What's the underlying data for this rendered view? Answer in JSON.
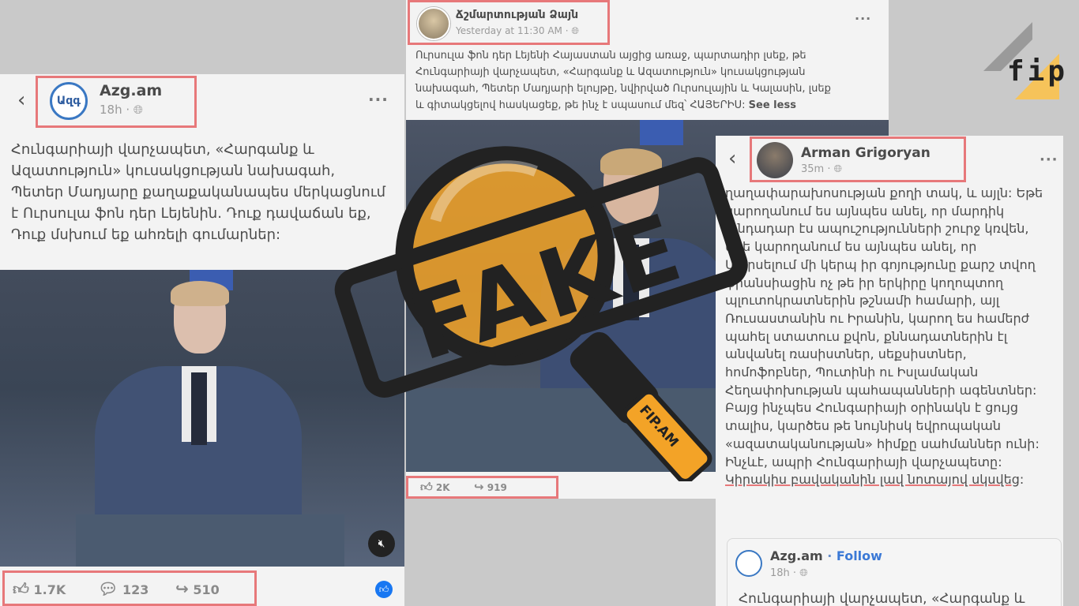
{
  "watermark": {
    "logo_text": "fip"
  },
  "post_center": {
    "page_name": "Ճշմարտության Ձայն",
    "time": "Yesterday at 11:30 AM · ",
    "text": "Ուրսուլա ֆոն դեր Լեյենի Հայաստան այցից առաջ, պարտադիր լսեք, թե Հունգարիայի վարչապետ, «Հարգանք և Ազատություն» կուսակցության նախագահ, Պետեր Մադյարի ելույթը, նվիրված Ուրսուլային և Կալասին, լսեք և գիտակցելով հասկացեք, թե ինչ է սպասում մեզ՝ ՀԱՅԵՐԻՍ: ",
    "see_less": "See less",
    "likes": "2K",
    "shares": "919"
  },
  "post_left": {
    "page_name": "Azg.am",
    "avatar_text": "Ազգ",
    "time": "18h · ",
    "text": "Հունգարիայի վարչապետ, «Հարգանք և Ազատություն» կուսակցության նախագահ, Պետեր Մադյարը քաղաքականապես մերկացնում է Ուրսուլա ֆոն դեր Լեյենին. Դուք դավաճան եք, Դուք մսխում եք ահռելի գումարներ:",
    "likes": "1.7K",
    "comments": "123",
    "shares": "510"
  },
  "post_right": {
    "author": "Arman Grigoryan",
    "time": "35m · ",
    "text": "ղաղափարախոսության քողի տակ, և այլն: Եթե կարողանում ես այնպես անել, որ մարդիկ անդադար էս ապուշությունների շուրջ կռվեն, եթե կարողանում ես այնպես անել, որ Մարսելում մի կերպ իր գոյությունը քարշ տվող ֆրանսիացին ոչ թե իր երկիրը կողոպտող պլուտոկրատներին թշնամի համարի, այլ Ռուսաստանին ու Իրանին, կարող ես համերժ պահել ստատուս քվոն, քննադատներին էլ անվանել ռասիստներ, սեքսիստներ, հոմոֆոբներ, Պուտինի ու Իսլամական Հեղափոխության պահապանների ագենտներ: Բայց ինչպես Հունգարիայի օրինակն է ցույց տալիս, կարծես թե նույնիսկ եվրոպական «ազատականության» հիմքը սահմաններ ունի: Ինչևէ, ապրի Հունգարիայի վարչապետը: ",
    "underlined": "Կիրակիս բավականին լավ նոտայով սկսվեց",
    "text_end": ":",
    "shared_page": "Azg.am",
    "shared_follow": "Follow",
    "shared_time": "18h · ",
    "shared_text": "Հունգարիայի վարչապետ, «Հարգանք և"
  },
  "stamp": {
    "label": "FAKE",
    "brand": "FIP.AM"
  },
  "colors": {
    "accent_red": "#e7787a",
    "stamp_orange": "#f3a327",
    "fb_blue": "#1877f2",
    "stamp_dark": "#222222"
  }
}
